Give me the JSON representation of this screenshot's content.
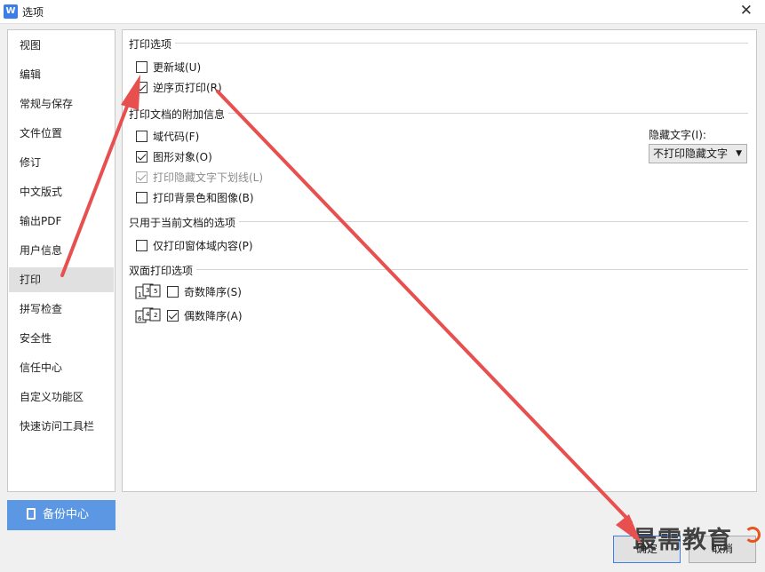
{
  "window": {
    "title": "选项",
    "app_icon": "W"
  },
  "sidebar": {
    "items": [
      {
        "label": "视图"
      },
      {
        "label": "编辑"
      },
      {
        "label": "常规与保存"
      },
      {
        "label": "文件位置"
      },
      {
        "label": "修订"
      },
      {
        "label": "中文版式"
      },
      {
        "label": "输出PDF"
      },
      {
        "label": "用户信息"
      },
      {
        "label": "打印",
        "active": true
      },
      {
        "label": "拼写检查"
      },
      {
        "label": "安全性"
      },
      {
        "label": "信任中心"
      },
      {
        "label": "自定义功能区"
      },
      {
        "label": "快速访问工具栏"
      }
    ],
    "backup_label": "备份中心"
  },
  "print_options": {
    "title": "打印选项",
    "update_fields": {
      "label": "更新域(U)",
      "checked": false
    },
    "reverse_order": {
      "label": "逆序页打印(R)",
      "checked": true
    }
  },
  "extra_info": {
    "title": "打印文档的附加信息",
    "field_codes": {
      "label": "域代码(F)",
      "checked": false
    },
    "drawing_objects": {
      "label": "图形对象(O)",
      "checked": true
    },
    "hidden_underline": {
      "label": "打印隐藏文字下划线(L)",
      "checked": true,
      "disabled": true
    },
    "background": {
      "label": "打印背景色和图像(B)",
      "checked": false
    },
    "hidden_text_label": "隐藏文字(I):",
    "hidden_text_value": "不打印隐藏文字"
  },
  "current_doc": {
    "title": "只用于当前文档的选项",
    "form_only": {
      "label": "仅打印窗体域内容(P)",
      "checked": false
    }
  },
  "duplex": {
    "title": "双面打印选项",
    "odd_reverse": {
      "label": "奇数降序(S)",
      "checked": false,
      "icon_pages": "1 3 5"
    },
    "even_reverse": {
      "label": "偶数降序(A)",
      "checked": true,
      "icon_pages": "6 4 2"
    }
  },
  "buttons": {
    "ok": "确定",
    "cancel": "取消"
  },
  "watermark": "最需教育",
  "colors": {
    "accent": "#3b7de9",
    "backup_bg": "#5b97e3",
    "arrow": "#e8504f"
  }
}
